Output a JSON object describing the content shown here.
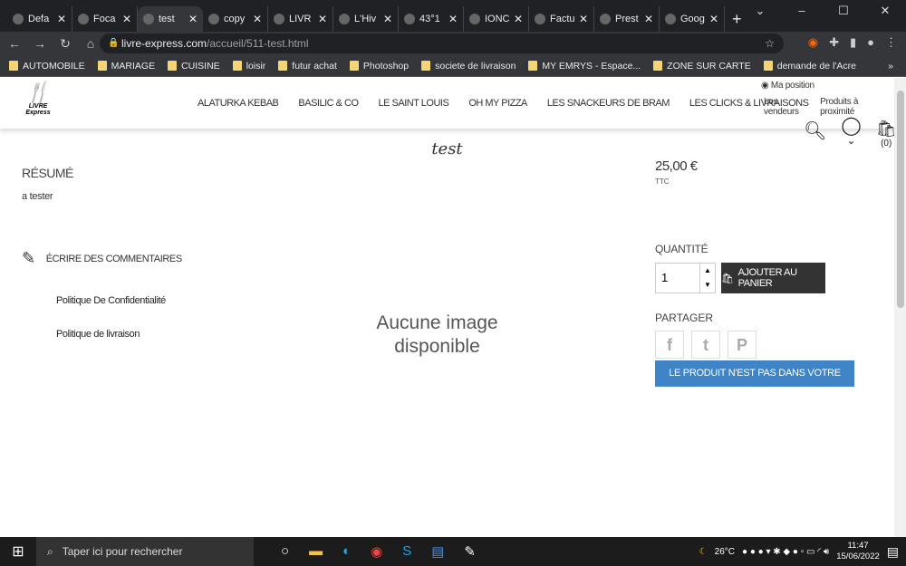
{
  "browser": {
    "tabs": [
      {
        "label": "Defa"
      },
      {
        "label": "Foca"
      },
      {
        "label": "test",
        "active": true
      },
      {
        "label": "copy"
      },
      {
        "label": "LIVR"
      },
      {
        "label": "L'Hiv"
      },
      {
        "label": "43°1"
      },
      {
        "label": "IONC"
      },
      {
        "label": "Factu"
      },
      {
        "label": "Prest"
      },
      {
        "label": "Goog"
      }
    ],
    "new_tab": "+",
    "url_host": "livre-express.com",
    "url_path": "/accueil/511-test.html",
    "bookmarks": [
      "AUTOMOBILE",
      "MARIAGE",
      "CUISINE",
      "loisir",
      "futur achat",
      "Photoshop",
      "societe de livraison",
      "MY EMRYS - Espace...",
      "ZONE SUR CARTE",
      "demande de l'Acre"
    ]
  },
  "site": {
    "logo_text": "LIVRE Express",
    "menu": [
      "ALATURKA KEBAB",
      "BASILIC & CO",
      "LE SAINT LOUIS",
      "OH MY PIZZA",
      "LES SNACKEURS DE BRAM",
      "LES CLICKS & LIVRAISONS"
    ],
    "position": "Ma position",
    "sellers": "Les vendeurs",
    "nearby": "Produits à proximité",
    "cart_count": "(0)"
  },
  "product": {
    "title": "test",
    "summary_label": "RÉSUMÉ",
    "summary": "a tester",
    "comment": "ÉCRIRE DES COMMENTAIRES",
    "links": [
      "Politique De Confidentialité",
      "Politique de livraison"
    ],
    "no_image": "Aucune image disponible",
    "price": "25,00 €",
    "tax": "TTC",
    "qty_label": "QUANTITÉ",
    "qty": "1",
    "add_to_cart": "AJOUTER AU PANIER",
    "share": "PARTAGER",
    "not_in_range": "LE PRODUIT N'EST PAS DANS VOTRE GAMME",
    "accent": "#3f84c6"
  },
  "taskbar": {
    "search": "Taper ici pour rechercher",
    "weather": "26°C",
    "time": "11:47",
    "date": "15/06/2022"
  }
}
